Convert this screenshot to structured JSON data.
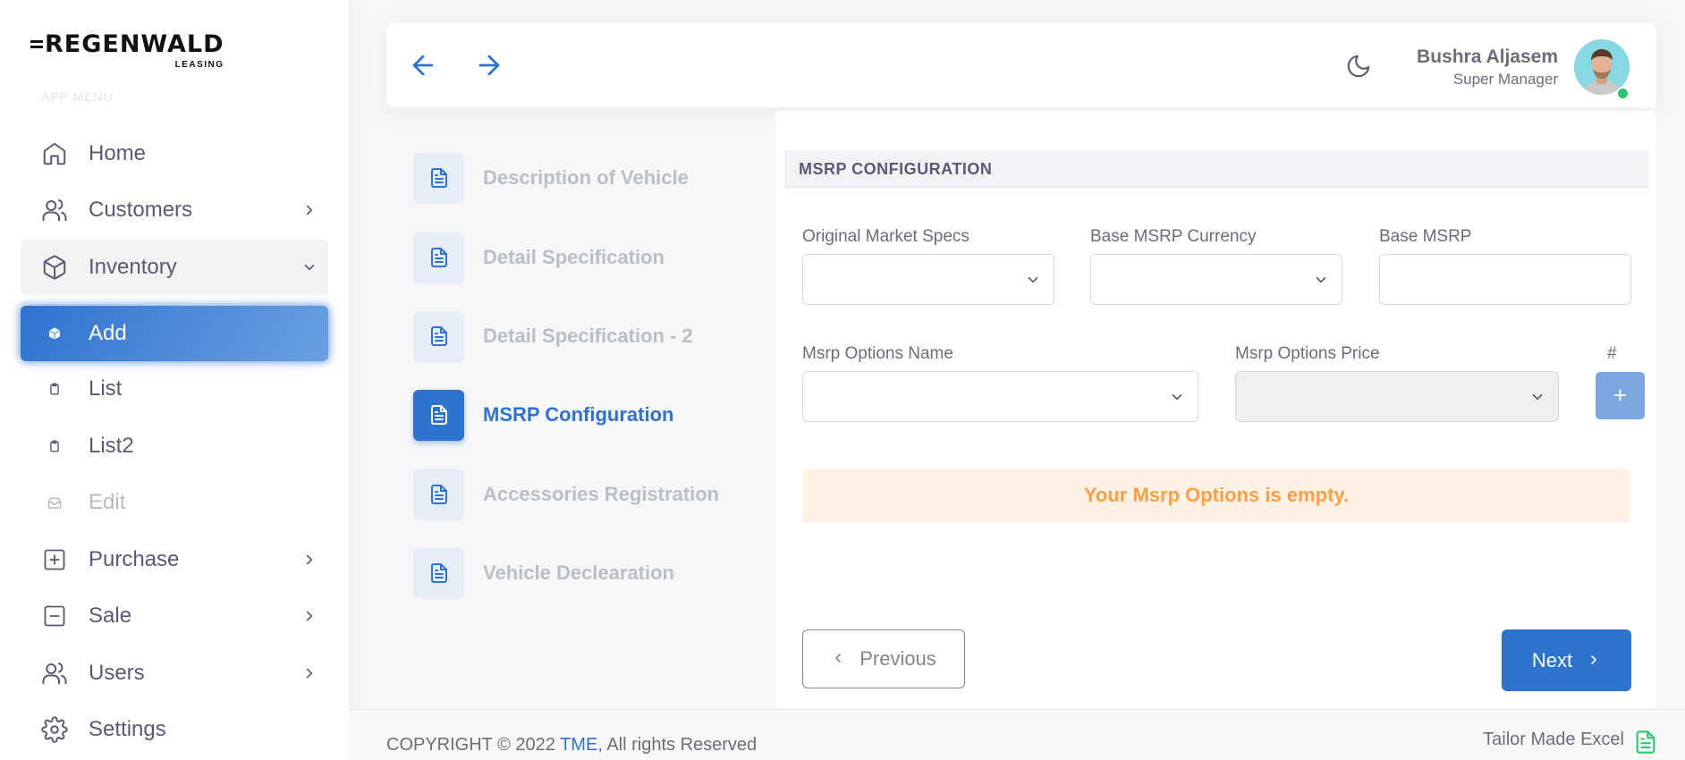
{
  "brand": {
    "name": "REGENWALD",
    "sub": "LEASING"
  },
  "sidebar": {
    "section_label": "APP MENU",
    "items": [
      {
        "label": "Home"
      },
      {
        "label": "Customers"
      },
      {
        "label": "Inventory"
      },
      {
        "label": "Add"
      },
      {
        "label": "List"
      },
      {
        "label": "List2"
      },
      {
        "label": "Edit"
      },
      {
        "label": "Purchase"
      },
      {
        "label": "Sale"
      },
      {
        "label": "Users"
      },
      {
        "label": "Settings"
      }
    ]
  },
  "header": {
    "user_name": "Bushra Aljasem",
    "user_role": "Super Manager"
  },
  "steps": [
    {
      "label": "Description of Vehicle"
    },
    {
      "label": "Detail Specification"
    },
    {
      "label": "Detail Specification - 2"
    },
    {
      "label": "MSRP Configuration"
    },
    {
      "label": "Accessories Registration"
    },
    {
      "label": "Vehicle Declearation"
    }
  ],
  "form": {
    "section_title": "MSRP CONFIGURATION",
    "original_market_specs_label": "Original Market Specs",
    "base_msrp_currency_label": "Base MSRP Currency",
    "base_msrp_label": "Base MSRP",
    "msrp_options_name_label": "Msrp Options Name",
    "msrp_options_price_label": "Msrp Options Price",
    "hash_label": "#",
    "add_symbol": "+",
    "empty_message": "Your Msrp Options is empty.",
    "previous_label": "Previous",
    "next_label": "Next"
  },
  "footer": {
    "copyright_prefix": "COPYRIGHT © 2022",
    "brand_link": "TME",
    "copyright_suffix": ", All rights Reserved",
    "tailor": "Tailor Made Excel"
  },
  "colors": {
    "primary": "#2f73d1",
    "warning": "#ff9f43",
    "warning_bg": "#fff2e5",
    "online": "#28c76f"
  },
  "icons": {
    "home": "home-icon",
    "customers": "users-icon",
    "inventory": "box-icon",
    "purchase": "plus-square-icon",
    "sale": "minus-square-icon",
    "users": "users-icon",
    "settings": "gear-icon",
    "step": "file-text-icon",
    "theme": "moon-icon",
    "back": "arrow-left-icon",
    "forward": "arrow-right-icon",
    "excel": "file-spreadsheet-icon"
  }
}
